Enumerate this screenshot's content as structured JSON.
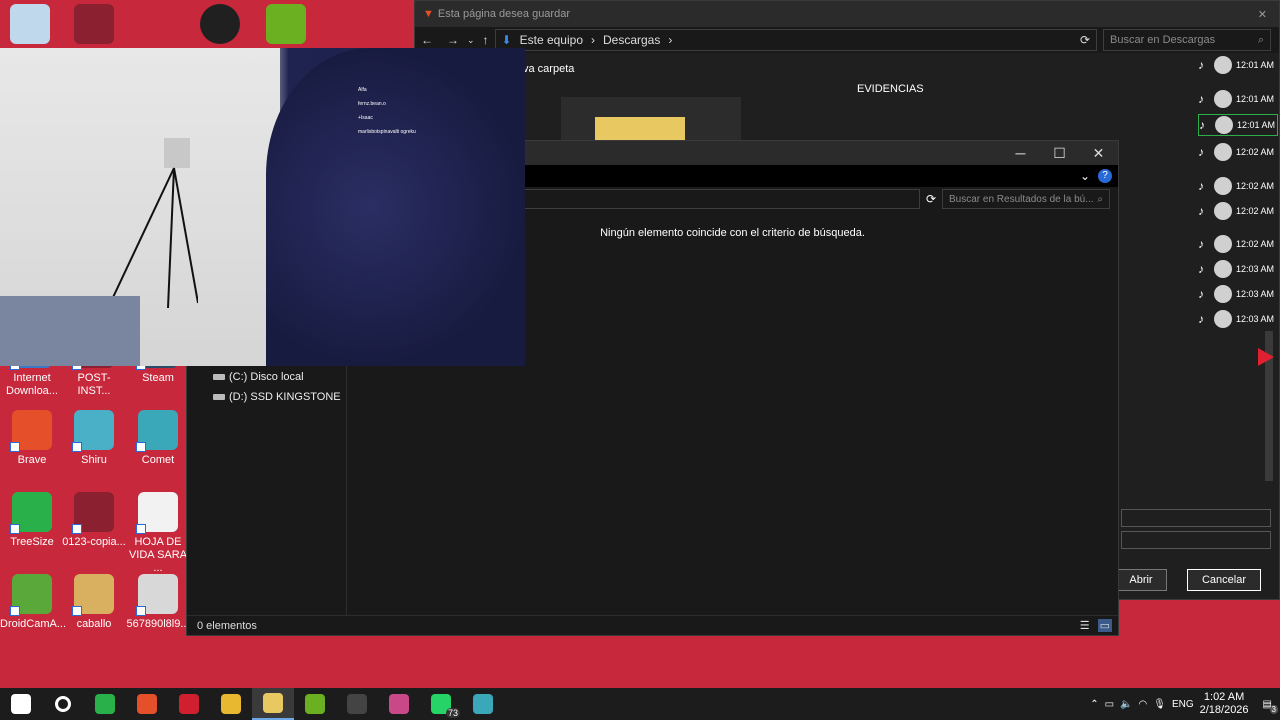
{
  "desktop_icons": [
    {
      "label": "Internet Downloa...",
      "color": "#3a78c8",
      "row": 0,
      "col": 0
    },
    {
      "label": "POST-INST...",
      "color": "#8a2030",
      "row": 0,
      "col": 1
    },
    {
      "label": "Steam",
      "color": "#2a4a6a",
      "row": 0,
      "col": 2
    },
    {
      "label": "Brave",
      "color": "#e5502b",
      "row": 1,
      "col": 0
    },
    {
      "label": "Shiru",
      "color": "#4ab0c8",
      "row": 1,
      "col": 1
    },
    {
      "label": "Comet",
      "color": "#3aa8b8",
      "row": 1,
      "col": 2
    },
    {
      "label": "TreeSize",
      "color": "#2ab04a",
      "row": 2,
      "col": 0
    },
    {
      "label": "0123-copia...",
      "color": "#8a2030",
      "row": 2,
      "col": 1
    },
    {
      "label": "HOJA DE VIDA SARA ...",
      "color": "#f2f2f2",
      "row": 2,
      "col": 2
    },
    {
      "label": "DroidCamA...",
      "color": "#5aa83a",
      "row": 3,
      "col": 0
    },
    {
      "label": "caballo",
      "color": "#d8b060",
      "row": 3,
      "col": 1
    },
    {
      "label": "567890l8l9...",
      "color": "#d8d8d8",
      "row": 3,
      "col": 2
    }
  ],
  "save_dialog": {
    "title": "Esta página desea guardar",
    "path": [
      "Este equipo",
      "Descargas"
    ],
    "search_placeholder": "Buscar en Descargas",
    "new_folder": "va carpeta",
    "folder_label": "EVIDENCIAS",
    "open_button": "Abrir",
    "cancel_button": "Cancelar"
  },
  "tiktok_feed": [
    "12:01 AM",
    "12:01 AM",
    "12:01 AM",
    "12:02 AM",
    "12:02 AM",
    "12:02 AM",
    "12:02 AM",
    "12:03 AM",
    "12:03 AM",
    "12:03 AM"
  ],
  "explorer": {
    "search_placeholder": "Buscar en Resultados de la bú...",
    "empty_message": "Ningún elemento coincide con el criterio de búsqueda.",
    "drives": [
      "(C:) Disco local",
      "(D:) SSD KINGSTONE"
    ],
    "status": "0 elementos"
  },
  "webcam_chat": [
    "Alfa",
    "fernz.bean.o",
    "+Isaac",
    "marlisbotspinavalti ogreku"
  ],
  "taskbar": {
    "apps": [
      "start-icon",
      "search-icon",
      "app-green-icon",
      "brave-icon",
      "red-app-icon",
      "chrome-icon",
      "file-explorer-icon",
      "nvidia-icon",
      "obs-icon",
      "app-pink-icon",
      "whatsapp-icon",
      "comet-icon"
    ],
    "whatsapp_badge": "73",
    "language": "ENG",
    "time": "1:02 AM",
    "date": "2/18/2026",
    "notifications": "3"
  }
}
